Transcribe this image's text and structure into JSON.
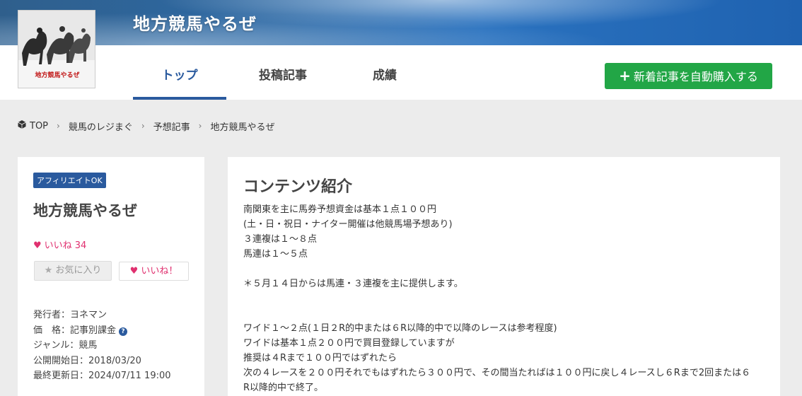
{
  "header": {
    "site_title": "地方競馬やるぜ",
    "logo_text": "地方競馬やるぜ",
    "tabs": [
      "トップ",
      "投稿記事",
      "成績"
    ],
    "auto_buy_button": "新着記事を自動購入する"
  },
  "breadcrumb": [
    "TOP",
    "競馬のレジまぐ",
    "予想記事",
    "地方競馬やるぜ"
  ],
  "sidebar": {
    "badge": "アフィリエイトOK",
    "title": "地方競馬やるぜ",
    "likes_label": "いいね 34",
    "favorite_button": "お気に入り",
    "like_button": "いいね！",
    "meta": [
      "発行者：ヨネマン",
      "価　格：記事別課金",
      "ジャンル：競馬",
      "公開開始日：2018/03/20",
      "最終更新日：2024/07/11 19:00"
    ]
  },
  "main": {
    "section_title": "コンテンツ紹介",
    "lines": [
      "南関東を主に馬券予想資金は基本１点１００円",
      "(土・日・祝日・ナイター開催は他競馬場予想あり)",
      "３連複は１～８点",
      "馬連は１～５点",
      "",
      "＊５月１４日からは馬連・３連複を主に提供します。",
      "",
      "",
      "ワイド１～２点(１日２R的中または６R以降的中で以降のレースは参考程度)",
      "ワイドは基本１点２００円で買目登録していますが",
      "推奨は４Rまで１００円ではずれたら",
      "次の４レースを２００円それでもはずれたら３００円で、その間当たればは１００円に戻し４レースし６Rまで2回または６",
      "R以降的中で終了。"
    ]
  },
  "colors": {
    "accent": "#2a5a9e",
    "buy_button": "#22a646",
    "like": "#e0306f"
  }
}
